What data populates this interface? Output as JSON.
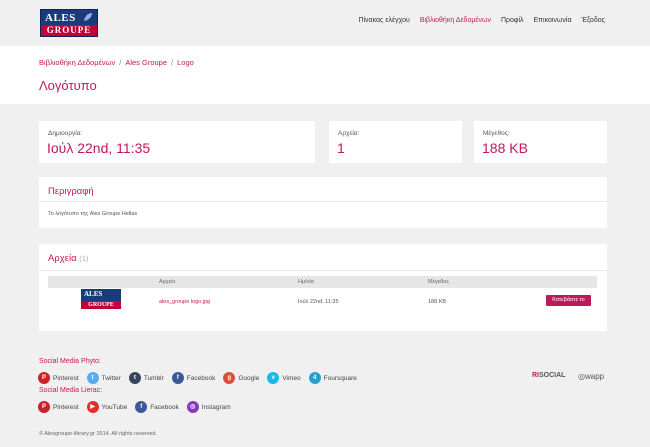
{
  "logo": {
    "top": "ALES",
    "bottom": "GROUPE"
  },
  "nav": {
    "items": [
      "Πίνακας ελέγχου",
      "Βιβλιοθήκη Δεδομένων",
      "Προφίλ",
      "Επικοινωνία",
      "Έξοδος"
    ],
    "active_index": 1
  },
  "breadcrumb": [
    "Βιβλιοθήκη Δεδομένων",
    "Ales Groupe",
    "Logo"
  ],
  "breadcrumb_sep": "/",
  "page_title": "Λογότυπο",
  "stats": {
    "created_label": "Δημιουργία:",
    "created_value": "Ιούλ 22nd, 11:35",
    "files_label": "Αρχεία:",
    "files_value": "1",
    "size_label": "Μέγεθος:",
    "size_value": "188 KB"
  },
  "description": {
    "title": "Περιγραφή",
    "text": "Το λογότυπο της Ales Groupe Hellas"
  },
  "files": {
    "title": "Αρχεία",
    "count": "(1)",
    "headers": [
      "Αρχείο",
      "Ημ/νία",
      "Μέγεθος"
    ],
    "rows": [
      {
        "name": "ales_groupe logo.jpg",
        "date": "Ιούλ 22nd, 11:35",
        "size": "188 KB",
        "button": "Κατεβάστε το",
        "thumb_top": "ALES",
        "thumb_bottom": "GROUPE"
      }
    ]
  },
  "social": {
    "phyto_title": "Social Media Phyto:",
    "phyto": [
      "Pinterest",
      "Twitter",
      "Tumblr",
      "Facebook",
      "Google",
      "Vimeo",
      "Foursquare"
    ],
    "lierac_title": "Social Media Lierac:",
    "lierac": [
      "Pinterest",
      "YouTube",
      "Facebook",
      "Instagram"
    ]
  },
  "brands": {
    "b1a": "RI",
    "b1b": "SOCIAL",
    "b2": "wapp"
  },
  "footer": "© Alesgroupe-library.gr 2014. All rights reserved.",
  "colors": {
    "accent": "#c2185b",
    "brand_blue": "#1a3a7a",
    "brand_red": "#c2003a"
  }
}
